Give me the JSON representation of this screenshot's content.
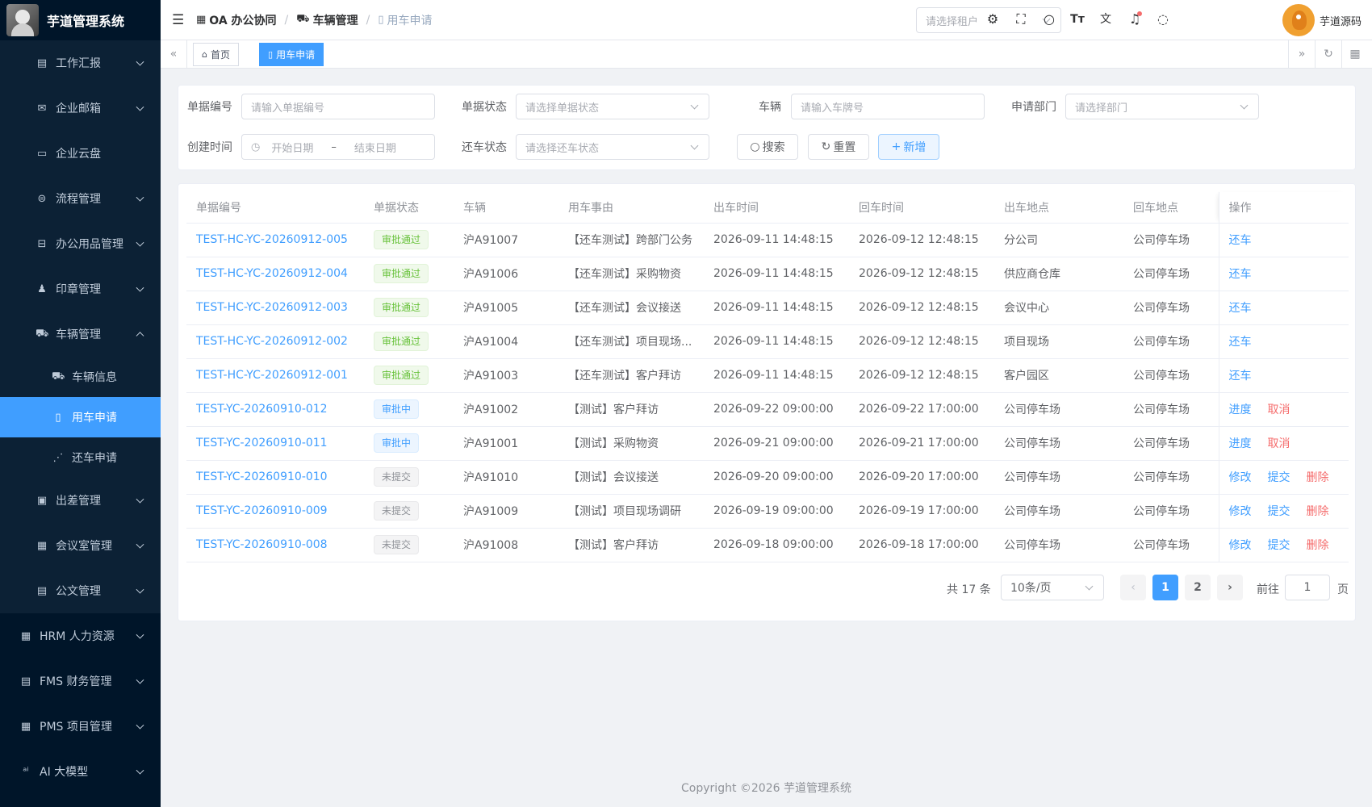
{
  "app": {
    "title": "芋道管理系统"
  },
  "sidebar": {
    "items": [
      {
        "label": "工作汇报",
        "icon": "report-icon",
        "glyph": "▤",
        "arrow": "down"
      },
      {
        "label": "企业邮箱",
        "icon": "mail-icon",
        "glyph": "✉",
        "arrow": "down"
      },
      {
        "label": "企业云盘",
        "icon": "folder-icon",
        "glyph": "▭",
        "arrow": ""
      },
      {
        "label": "流程管理",
        "icon": "flow-icon",
        "glyph": "⊜",
        "arrow": "down"
      },
      {
        "label": "办公用品管理",
        "icon": "supplies-icon",
        "glyph": "⊟",
        "arrow": "down"
      },
      {
        "label": "印章管理",
        "icon": "seal-icon",
        "glyph": "♟",
        "arrow": "down"
      },
      {
        "label": "车辆管理",
        "icon": "vehicle-icon",
        "glyph": "⛟",
        "arrow": "up"
      },
      {
        "label": "车辆信息",
        "icon": "vehicle-info-icon",
        "glyph": "⛟",
        "arrow": ""
      },
      {
        "label": "用车申请",
        "icon": "document-icon",
        "glyph": "▯",
        "arrow": ""
      },
      {
        "label": "还车申请",
        "icon": "return-icon",
        "glyph": "⋰",
        "arrow": ""
      },
      {
        "label": "出差管理",
        "icon": "briefcase-icon",
        "glyph": "▣",
        "arrow": "down"
      },
      {
        "label": "会议室管理",
        "icon": "building-icon",
        "glyph": "▦",
        "arrow": "down"
      },
      {
        "label": "公文管理",
        "icon": "docs-icon",
        "glyph": "▤",
        "arrow": "down"
      },
      {
        "label": "HRM 人力资源",
        "icon": "hrm-icon",
        "glyph": "▦",
        "arrow": "down"
      },
      {
        "label": "FMS 财务管理",
        "icon": "fms-icon",
        "glyph": "▤",
        "arrow": "down"
      },
      {
        "label": "PMS 项目管理",
        "icon": "pms-icon",
        "glyph": "▦",
        "arrow": "down"
      },
      {
        "label": "AI 大模型",
        "icon": "ai-icon",
        "glyph": "ᵃⁱ",
        "arrow": "down"
      }
    ]
  },
  "header": {
    "breadcrumb": [
      "OA 办公协同",
      "车辆管理",
      "用车申请"
    ],
    "tenant_placeholder": "请选择租户",
    "username": "芋道源码"
  },
  "tags": {
    "home": "首页",
    "current": "用车申请"
  },
  "search": {
    "code_label": "单据编号",
    "code_placeholder": "请输入单据编号",
    "status_label": "单据状态",
    "status_placeholder": "请选择单据状态",
    "car_label": "车辆",
    "car_placeholder": "请输入车牌号",
    "dept_label": "申请部门",
    "dept_placeholder": "请选择部门",
    "time_label": "创建时间",
    "start_placeholder": "开始日期",
    "range_sep": "–",
    "end_placeholder": "结束日期",
    "return_label": "还车状态",
    "return_placeholder": "请选择还车状态",
    "search_btn": "搜索",
    "reset_btn": "重置",
    "add_btn": "新增"
  },
  "table": {
    "columns": [
      "单据编号",
      "单据状态",
      "车辆",
      "用车事由",
      "出车时间",
      "回车时间",
      "出车地点",
      "回车地点",
      "操作"
    ],
    "rows": [
      {
        "code": "TEST-HC-YC-20260912-005",
        "status": "审批通过",
        "type": "success",
        "car": "沪A91007",
        "reason": "【还车测试】跨部门公务",
        "out": "2026-09-11 14:48:15",
        "back": "2026-09-12 12:48:15",
        "from": "分公司",
        "to": "公司停车场",
        "ops": [
          {
            "t": "还车",
            "c": "link"
          }
        ]
      },
      {
        "code": "TEST-HC-YC-20260912-004",
        "status": "审批通过",
        "type": "success",
        "car": "沪A91006",
        "reason": "【还车测试】采购物资",
        "out": "2026-09-11 14:48:15",
        "back": "2026-09-12 12:48:15",
        "from": "供应商仓库",
        "to": "公司停车场",
        "ops": [
          {
            "t": "还车",
            "c": "link"
          }
        ]
      },
      {
        "code": "TEST-HC-YC-20260912-003",
        "status": "审批通过",
        "type": "success",
        "car": "沪A91005",
        "reason": "【还车测试】会议接送",
        "out": "2026-09-11 14:48:15",
        "back": "2026-09-12 12:48:15",
        "from": "会议中心",
        "to": "公司停车场",
        "ops": [
          {
            "t": "还车",
            "c": "link"
          }
        ]
      },
      {
        "code": "TEST-HC-YC-20260912-002",
        "status": "审批通过",
        "type": "success",
        "car": "沪A91004",
        "reason": "【还车测试】项目现场...",
        "out": "2026-09-11 14:48:15",
        "back": "2026-09-12 12:48:15",
        "from": "项目现场",
        "to": "公司停车场",
        "ops": [
          {
            "t": "还车",
            "c": "link"
          }
        ]
      },
      {
        "code": "TEST-HC-YC-20260912-001",
        "status": "审批通过",
        "type": "success",
        "car": "沪A91003",
        "reason": "【还车测试】客户拜访",
        "out": "2026-09-11 14:48:15",
        "back": "2026-09-12 12:48:15",
        "from": "客户园区",
        "to": "公司停车场",
        "ops": [
          {
            "t": "还车",
            "c": "link"
          }
        ]
      },
      {
        "code": "TEST-YC-20260910-012",
        "status": "审批中",
        "type": "primary",
        "car": "沪A91002",
        "reason": "【测试】客户拜访",
        "out": "2026-09-22 09:00:00",
        "back": "2026-09-22 17:00:00",
        "from": "公司停车场",
        "to": "公司停车场",
        "ops": [
          {
            "t": "进度",
            "c": "link"
          },
          {
            "t": "取消",
            "c": "danger"
          }
        ]
      },
      {
        "code": "TEST-YC-20260910-011",
        "status": "审批中",
        "type": "primary",
        "car": "沪A91001",
        "reason": "【测试】采购物资",
        "out": "2026-09-21 09:00:00",
        "back": "2026-09-21 17:00:00",
        "from": "公司停车场",
        "to": "公司停车场",
        "ops": [
          {
            "t": "进度",
            "c": "link"
          },
          {
            "t": "取消",
            "c": "danger"
          }
        ]
      },
      {
        "code": "TEST-YC-20260910-010",
        "status": "未提交",
        "type": "info",
        "car": "沪A91010",
        "reason": "【测试】会议接送",
        "out": "2026-09-20 09:00:00",
        "back": "2026-09-20 17:00:00",
        "from": "公司停车场",
        "to": "公司停车场",
        "ops": [
          {
            "t": "修改",
            "c": "link"
          },
          {
            "t": "提交",
            "c": "link"
          },
          {
            "t": "删除",
            "c": "danger"
          }
        ]
      },
      {
        "code": "TEST-YC-20260910-009",
        "status": "未提交",
        "type": "info",
        "car": "沪A91009",
        "reason": "【测试】项目现场调研",
        "out": "2026-09-19 09:00:00",
        "back": "2026-09-19 17:00:00",
        "from": "公司停车场",
        "to": "公司停车场",
        "ops": [
          {
            "t": "修改",
            "c": "link"
          },
          {
            "t": "提交",
            "c": "link"
          },
          {
            "t": "删除",
            "c": "danger"
          }
        ]
      },
      {
        "code": "TEST-YC-20260910-008",
        "status": "未提交",
        "type": "info",
        "car": "沪A91008",
        "reason": "【测试】客户拜访",
        "out": "2026-09-18 09:00:00",
        "back": "2026-09-18 17:00:00",
        "from": "公司停车场",
        "to": "公司停车场",
        "ops": [
          {
            "t": "修改",
            "c": "link"
          },
          {
            "t": "提交",
            "c": "link"
          },
          {
            "t": "删除",
            "c": "danger"
          }
        ]
      }
    ]
  },
  "pagination": {
    "total": "共 17 条",
    "page_size": "10条/页",
    "pages": [
      "1",
      "2"
    ],
    "goto_label": "前往",
    "goto_value": "1",
    "page_suffix": "页"
  },
  "footer": {
    "copyright": "Copyright ©2026 芋道管理系统"
  }
}
